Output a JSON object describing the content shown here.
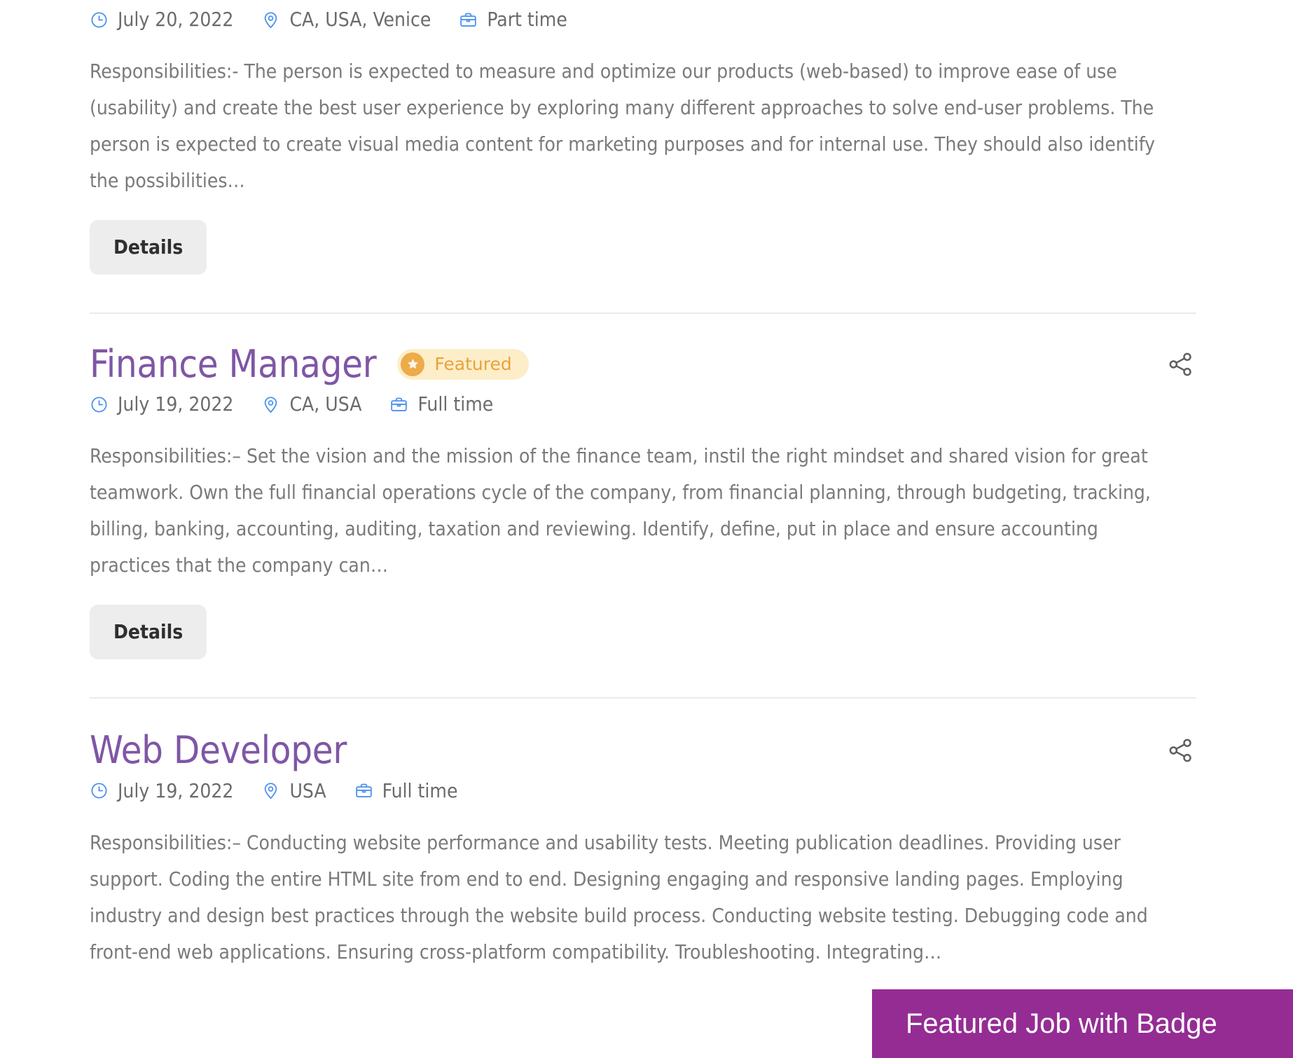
{
  "jobs": [
    {
      "title": "",
      "featured": false,
      "meta": {
        "date": "July 20, 2022",
        "location": "CA, USA, Venice",
        "type": "Part time"
      },
      "description": "Responsibilities:- The person is expected to measure and optimize our products (web-based) to improve ease of use (usability) and create the best user experience by exploring many different approaches to solve end-user problems. The person is expected to create visual media content for marketing purposes and for internal use. They should also identify the possibilities…",
      "details_label": "Details"
    },
    {
      "title": "Finance Manager",
      "featured": true,
      "badge_label": "Featured",
      "meta": {
        "date": "July 19, 2022",
        "location": "CA, USA",
        "type": "Full time"
      },
      "description": "Responsibilities:– Set the vision and the mission of the finance team, instil the right mindset and shared vision for great teamwork. Own the full financial operations cycle of the company, from financial planning, through budgeting, tracking, billing, banking, accounting, auditing, taxation and reviewing. Identify, define, put in place and ensure accounting practices that the company can…",
      "details_label": "Details"
    },
    {
      "title": "Web Developer",
      "featured": false,
      "meta": {
        "date": "July 19, 2022",
        "location": "USA",
        "type": "Full time"
      },
      "description": "Responsibilities:– Conducting website performance and usability tests. Meeting publication deadlines. Providing user support. Coding the entire HTML site from end to end. Designing engaging and responsive landing pages. Employing industry and design best practices through the website build process. Conducting website testing. Debugging code and front-end web applications. Ensuring cross-platform compatibility. Troubleshooting. Integrating…"
    }
  ],
  "annotation": {
    "label": "Featured Job with Badge",
    "background_color": "#942c94",
    "text_color": "#ffffff"
  },
  "colors": {
    "title_purple": "#7f56a5",
    "meta_icon_blue": "#4a90f0",
    "badge_bg": "#fdeec9",
    "badge_text": "#e9a23b",
    "badge_circle": "#edab4a",
    "button_bg": "#ededed",
    "body_text": "#7a7a7a",
    "divider": "#ebebeb"
  },
  "icons": {
    "clock": "clock-icon",
    "location": "location-pin-icon",
    "job_type": "briefcase-icon",
    "share": "share-icon",
    "star": "star-icon"
  }
}
